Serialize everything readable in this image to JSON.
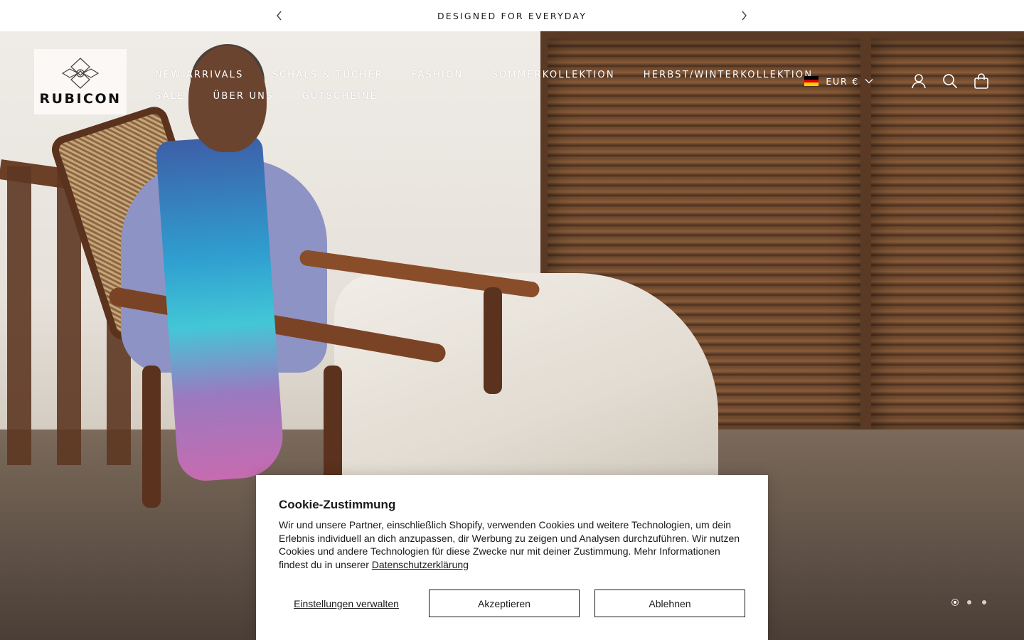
{
  "announcement": {
    "text": "DESIGNED FOR EVERYDAY",
    "prev_icon": "chevron-left-icon",
    "next_icon": "chevron-right-icon"
  },
  "header": {
    "logo_text": "RUBICON",
    "nav_row1": [
      "NEW ARRIVALS",
      "SCHALS & TÜCHER",
      "FASHION",
      "SOMMERKOLLEKTION",
      "HERBST/WINTERKOLLEKTION"
    ],
    "nav_row2": [
      "SALE",
      "ÜBER UNS",
      "GUTSCHEINE"
    ],
    "currency": {
      "label": "EUR €",
      "flag_colors": [
        "#000000",
        "#dd0000",
        "#ffce00"
      ]
    },
    "icons": [
      "account-icon",
      "search-icon",
      "cart-icon"
    ]
  },
  "hero": {
    "slide_count": 3,
    "active_slide": 1
  },
  "cookie": {
    "title": "Cookie-Zustimmung",
    "body": "Wir und unsere Partner, einschließlich Shopify, verwenden Cookies und weitere Technologien, um dein Erlebnis individuell an dich anzupassen, dir Werbung zu zeigen und Analysen durchzuführen. Wir nutzen Cookies und andere Technologien für diese Zwecke nur mit deiner Zustimmung. Mehr Informationen findest du in unserer ",
    "privacy_link": "Datenschutzerklärung",
    "manage_label": "Einstellungen verwalten",
    "accept_label": "Akzeptieren",
    "decline_label": "Ablehnen"
  }
}
